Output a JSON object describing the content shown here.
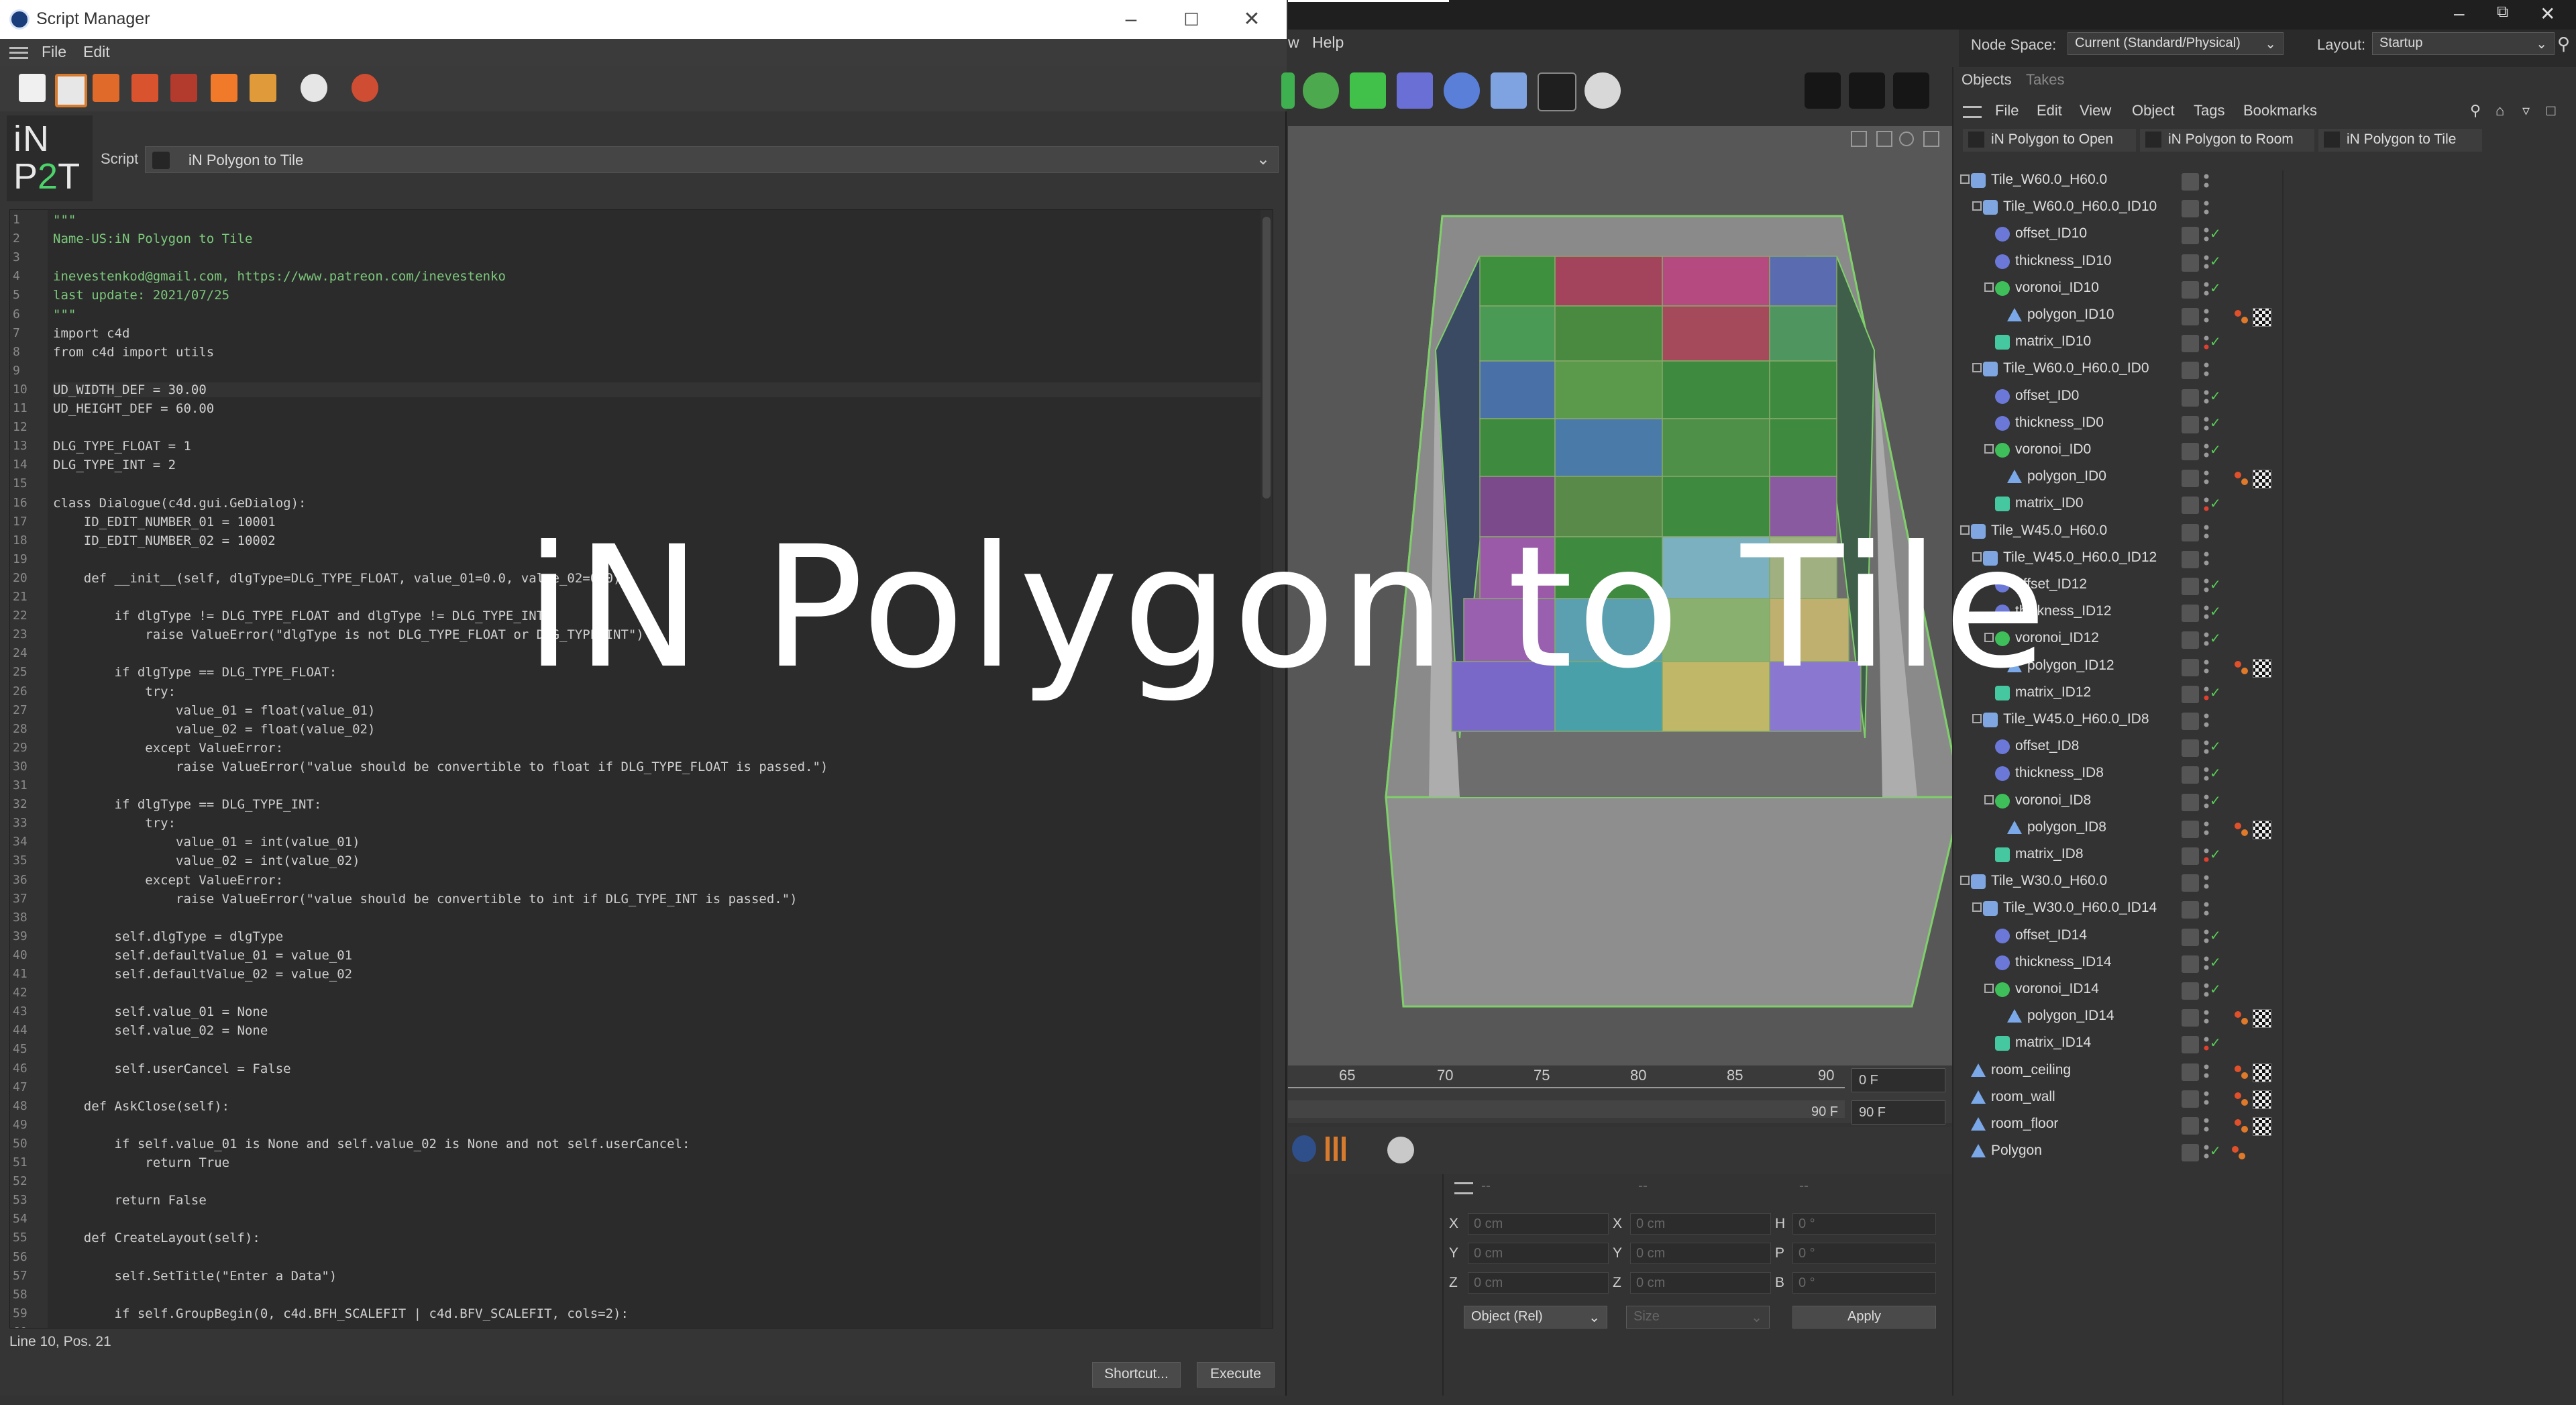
{
  "script_manager": {
    "title": "Script Manager",
    "menu": [
      "File",
      "Edit"
    ],
    "logo": {
      "line1": "iN",
      "line2_a": "P",
      "line2_b": "2",
      "line2_c": "T"
    },
    "script_label": "Script",
    "script_selected": "iN Polygon to Tile",
    "status": "Line 10, Pos. 21",
    "shortcut_button": "Shortcut...",
    "execute_button": "Execute",
    "code_lines": [
      "\"\"\"",
      "Name-US:iN Polygon to Tile",
      "",
      "inevestenkod@gmail.com, https://www.patreon.com/inevestenko",
      "last update: 2021/07/25",
      "\"\"\"",
      "import c4d",
      "from c4d import utils",
      "",
      "UD_WIDTH_DEF = 30.00",
      "UD_HEIGHT_DEF = 60.00",
      "",
      "DLG_TYPE_FLOAT = 1",
      "DLG_TYPE_INT = 2",
      "",
      "class Dialogue(c4d.gui.GeDialog):",
      "    ID_EDIT_NUMBER_01 = 10001",
      "    ID_EDIT_NUMBER_02 = 10002",
      "",
      "    def __init__(self, dlgType=DLG_TYPE_FLOAT, value_01=0.0, value_02=0.0):",
      "",
      "        if dlgType != DLG_TYPE_FLOAT and dlgType != DLG_TYPE_INT:",
      "            raise ValueError(\"dlgType is not DLG_TYPE_FLOAT or DLG_TYPE_INT\")",
      "",
      "        if dlgType == DLG_TYPE_FLOAT:",
      "            try:",
      "                value_01 = float(value_01)",
      "                value_02 = float(value_02)",
      "            except ValueError:",
      "                raise ValueError(\"value should be convertible to float if DLG_TYPE_FLOAT is passed.\")",
      "",
      "        if dlgType == DLG_TYPE_INT:",
      "            try:",
      "                value_01 = int(value_01)",
      "                value_02 = int(value_02)",
      "            except ValueError:",
      "                raise ValueError(\"value should be convertible to int if DLG_TYPE_INT is passed.\")",
      "",
      "        self.dlgType = dlgType",
      "        self.defaultValue_01 = value_01",
      "        self.defaultValue_02 = value_02",
      "",
      "        self.value_01 = None",
      "        self.value_02 = None",
      "",
      "        self.userCancel = False",
      "",
      "    def AskClose(self):",
      "",
      "        if self.value_01 is None and self.value_02 is None and not self.userCancel:",
      "            return True",
      "",
      "        return False",
      "",
      "    def CreateLayout(self):",
      "",
      "        self.SetTitle(\"Enter a Data\")",
      "",
      "        if self.GroupBegin(0, c4d.BFH_SCALEFIT | c4d.BFV_SCALEFIT, cols=2):",
      ""
    ]
  },
  "c4d": {
    "menu_partial": [
      "w",
      "Help"
    ],
    "node_space_label": "Node Space:",
    "node_space_value": "Current (Standard/Physical)",
    "layout_label": "Layout:",
    "layout_value": "Startup",
    "timeline_ticks": [
      "65",
      "70",
      "75",
      "80",
      "85",
      "90"
    ],
    "frame_current": "0 F",
    "frame_end": "90 F",
    "frame_end_left": "90 F",
    "coord": {
      "x_label": "X",
      "y_label": "Y",
      "z_label": "Z",
      "h_label": "H",
      "p_label": "P",
      "b_label": "B",
      "x_val": "0 cm",
      "y_val": "0 cm",
      "z_val": "0 cm",
      "sx_val": "0 cm",
      "sy_val": "0 cm",
      "sz_val": "0 cm",
      "h_val": "0 °",
      "p_val": "0 °",
      "b_val": "0 °",
      "mode": "Object (Rel)",
      "size": "Size",
      "apply": "Apply",
      "dash": "--"
    }
  },
  "objects_panel": {
    "tabs": [
      "Objects",
      "Takes"
    ],
    "menu": [
      "File",
      "Edit",
      "View",
      "Object",
      "Tags",
      "Bookmarks"
    ],
    "bookmarks": [
      "iN Polygon to Open",
      "iN Polygon to Room",
      "iN Polygon to Tile"
    ],
    "tree": [
      {
        "name": "Tile_W60.0_H60.0",
        "depth": 0,
        "type": "null",
        "expanded": true
      },
      {
        "name": "Tile_W60.0_H60.0_ID10",
        "depth": 1,
        "type": "null",
        "expanded": true
      },
      {
        "name": "offset_ID10",
        "depth": 2,
        "type": "effector",
        "check": true
      },
      {
        "name": "thickness_ID10",
        "depth": 2,
        "type": "effector",
        "check": true
      },
      {
        "name": "voronoi_ID10",
        "depth": 2,
        "type": "voronoi",
        "check": true,
        "expanded": true
      },
      {
        "name": "polygon_ID10",
        "depth": 3,
        "type": "poly",
        "tags": true
      },
      {
        "name": "matrix_ID10",
        "depth": 2,
        "type": "matrix",
        "check": true
      },
      {
        "name": "Tile_W60.0_H60.0_ID0",
        "depth": 1,
        "type": "null",
        "expanded": true
      },
      {
        "name": "offset_ID0",
        "depth": 2,
        "type": "effector",
        "check": true
      },
      {
        "name": "thickness_ID0",
        "depth": 2,
        "type": "effector",
        "check": true
      },
      {
        "name": "voronoi_ID0",
        "depth": 2,
        "type": "voronoi",
        "check": true,
        "expanded": true
      },
      {
        "name": "polygon_ID0",
        "depth": 3,
        "type": "poly",
        "tags": true
      },
      {
        "name": "matrix_ID0",
        "depth": 2,
        "type": "matrix",
        "check": true
      },
      {
        "name": "Tile_W45.0_H60.0",
        "depth": 0,
        "type": "null",
        "expanded": true
      },
      {
        "name": "Tile_W45.0_H60.0_ID12",
        "depth": 1,
        "type": "null",
        "expanded": true
      },
      {
        "name": "offset_ID12",
        "depth": 2,
        "type": "effector",
        "check": true
      },
      {
        "name": "thickness_ID12",
        "depth": 2,
        "type": "effector",
        "check": true
      },
      {
        "name": "voronoi_ID12",
        "depth": 2,
        "type": "voronoi",
        "check": true,
        "expanded": true
      },
      {
        "name": "polygon_ID12",
        "depth": 3,
        "type": "poly",
        "tags": true
      },
      {
        "name": "matrix_ID12",
        "depth": 2,
        "type": "matrix",
        "check": true
      },
      {
        "name": "Tile_W45.0_H60.0_ID8",
        "depth": 1,
        "type": "null",
        "expanded": true
      },
      {
        "name": "offset_ID8",
        "depth": 2,
        "type": "effector",
        "check": true
      },
      {
        "name": "thickness_ID8",
        "depth": 2,
        "type": "effector",
        "check": true
      },
      {
        "name": "voronoi_ID8",
        "depth": 2,
        "type": "voronoi",
        "check": true,
        "expanded": true
      },
      {
        "name": "polygon_ID8",
        "depth": 3,
        "type": "poly",
        "tags": true
      },
      {
        "name": "matrix_ID8",
        "depth": 2,
        "type": "matrix",
        "check": true
      },
      {
        "name": "Tile_W30.0_H60.0",
        "depth": 0,
        "type": "null",
        "expanded": true
      },
      {
        "name": "Tile_W30.0_H60.0_ID14",
        "depth": 1,
        "type": "null",
        "expanded": true
      },
      {
        "name": "offset_ID14",
        "depth": 2,
        "type": "effector",
        "check": true
      },
      {
        "name": "thickness_ID14",
        "depth": 2,
        "type": "effector",
        "check": true
      },
      {
        "name": "voronoi_ID14",
        "depth": 2,
        "type": "voronoi",
        "check": true,
        "expanded": true
      },
      {
        "name": "polygon_ID14",
        "depth": 3,
        "type": "poly",
        "tags": true
      },
      {
        "name": "matrix_ID14",
        "depth": 2,
        "type": "matrix",
        "check": true
      },
      {
        "name": "room_ceiling",
        "depth": 0,
        "type": "poly",
        "tags": true
      },
      {
        "name": "room_wall",
        "depth": 0,
        "type": "poly",
        "tags": true
      },
      {
        "name": "room_floor",
        "depth": 0,
        "type": "poly",
        "tags": true
      },
      {
        "name": "Polygon",
        "depth": 0,
        "type": "poly",
        "check": true,
        "phong": true
      }
    ]
  },
  "watermark": "iN Polygon to Tile",
  "colors": {
    "accent_green": "#4cd36b",
    "check_green": "#58d058",
    "code_string": "#7cc97c"
  }
}
